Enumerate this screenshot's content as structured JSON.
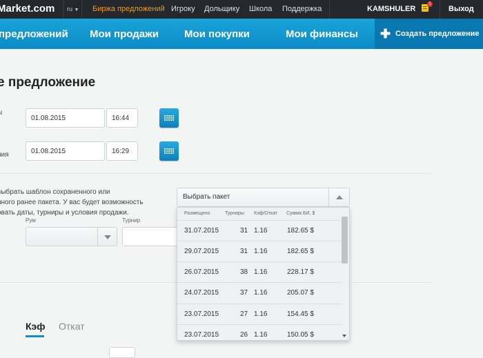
{
  "topbar": {
    "logo": "Market.com",
    "lang": "ru",
    "links": [
      "Биржа предложений",
      "Игроку",
      "Дольщику",
      "Школа",
      "Поддержка"
    ],
    "username": "KAMSHULER",
    "notifications_count": "1",
    "logout": "Выход"
  },
  "mainnav": {
    "items": [
      "предложений",
      "Мои продажи",
      "Мои покупки",
      "Мои финансы"
    ],
    "create_label": "Создать предложение"
  },
  "page": {
    "title": "е предложение",
    "row1_label": "ы",
    "row2_label": "ния",
    "date1": "01.08.2015",
    "time1": "16:44",
    "date2": "01.08.2015",
    "time2": "16:29",
    "info_lines": [
      "выбрать шаблон сохраненного или",
      "нного ранее пакета. У вас будет возможность",
      "овать даты, турниры и условия продажи."
    ],
    "rum_label": "Рум",
    "tournament_label": "Турнир",
    "tabs": [
      "Кэф",
      "Откат"
    ]
  },
  "package_select": {
    "placeholder": "Выбрать пакет",
    "columns": [
      "Размещено",
      "Турниры",
      "Кэф/Откат",
      "Сумма БИ, $"
    ],
    "rows": [
      {
        "date": "31.07.2015",
        "tournaments": "31",
        "kef": "1.16",
        "sum": "182.65 $"
      },
      {
        "date": "29.07.2015",
        "tournaments": "31",
        "kef": "1.16",
        "sum": "182.65 $"
      },
      {
        "date": "26.07.2015",
        "tournaments": "38",
        "kef": "1.16",
        "sum": "228.17 $"
      },
      {
        "date": "24.07.2015",
        "tournaments": "37",
        "kef": "1.16",
        "sum": "205.07 $"
      },
      {
        "date": "23.07.2015",
        "tournaments": "27",
        "kef": "1.16",
        "sum": "154.45 $"
      },
      {
        "date": "23.07.2015",
        "tournaments": "26",
        "kef": "1.16",
        "sum": "150.05 $"
      }
    ]
  }
}
